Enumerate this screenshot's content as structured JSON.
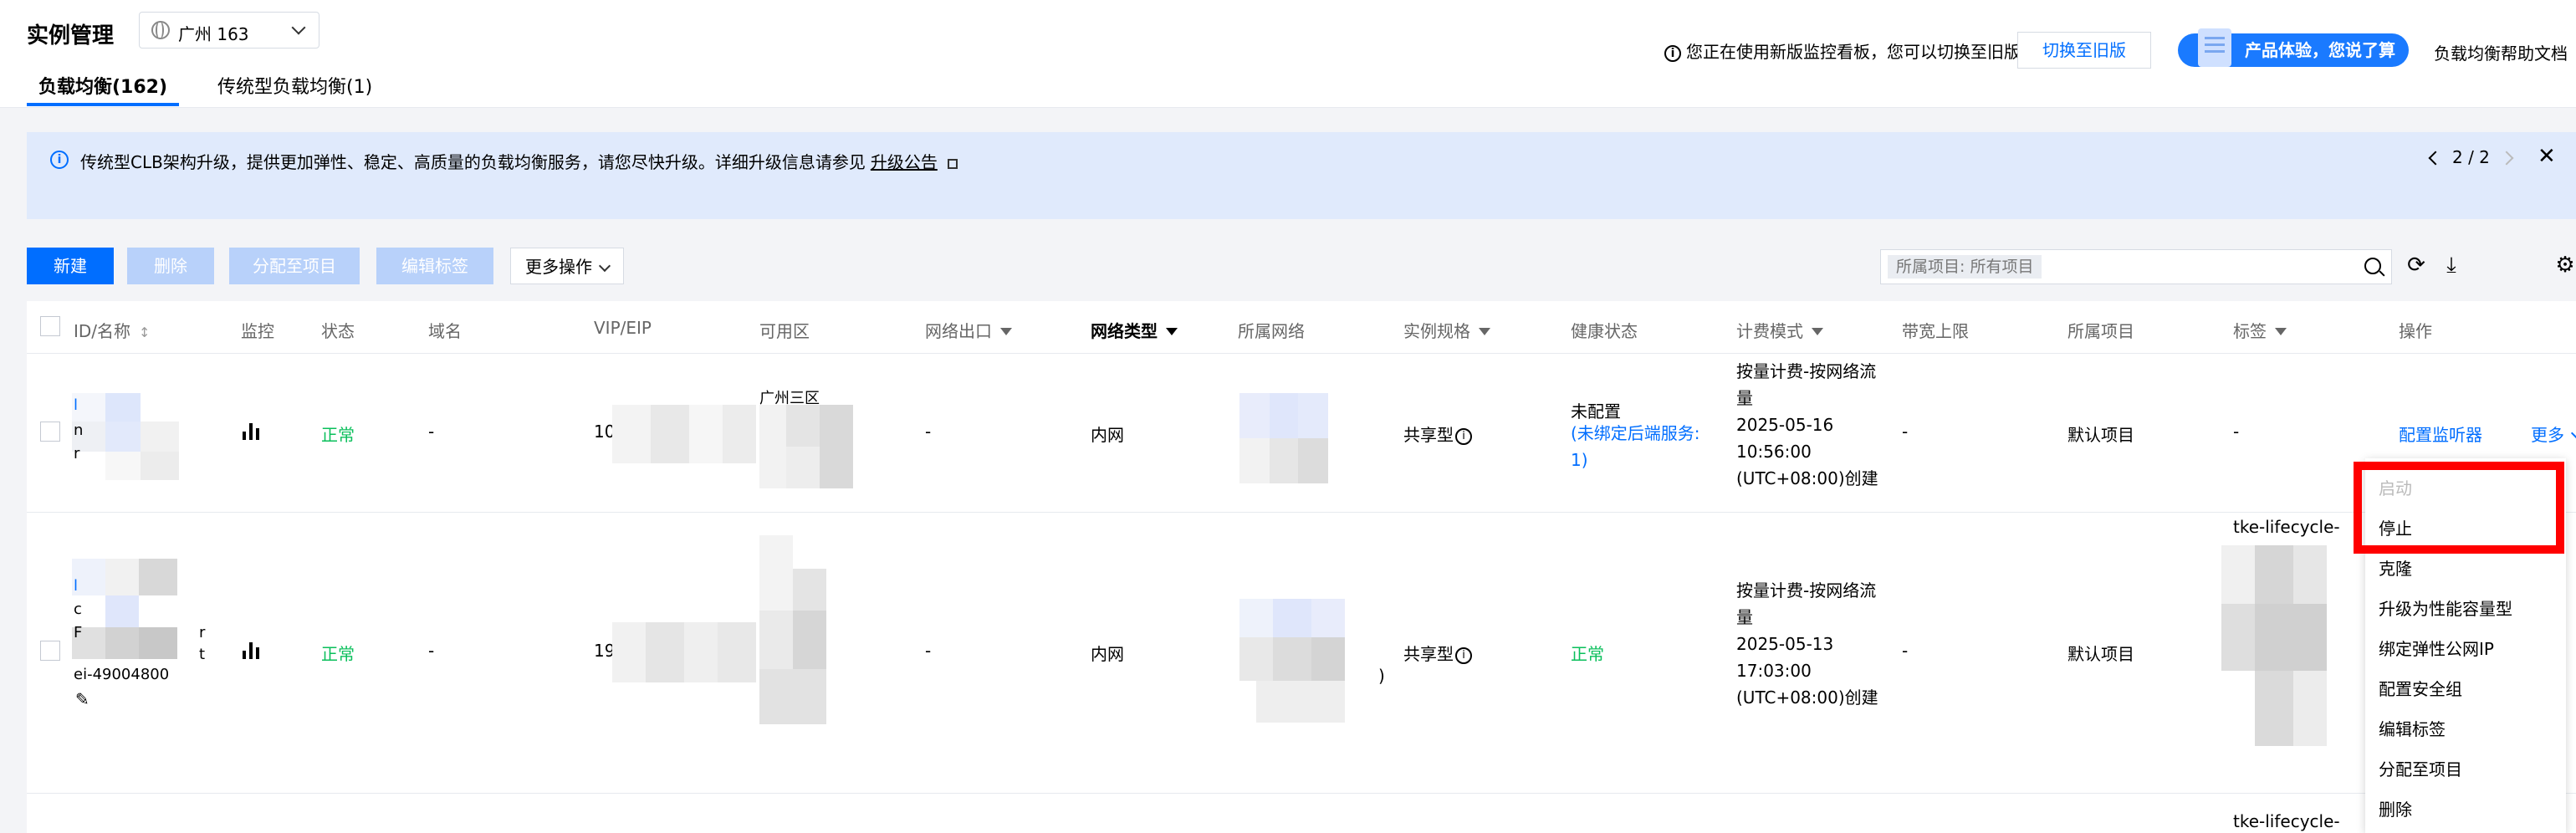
{
  "header": {
    "title": "实例管理",
    "region": "广州 163",
    "tabs": [
      {
        "label": "负载均衡(162)",
        "active": true
      },
      {
        "label": "传统型负载均衡(1)",
        "active": false
      }
    ],
    "monitor_notice": "您正在使用新版监控看板，您可以切换至旧版",
    "switch_button": "切换至旧版",
    "feedback_pill": "产品体验，您说了算",
    "help_doc": "负载均衡帮助文档"
  },
  "banner": {
    "text": "传统型CLB架构升级，提供更加弹性、稳定、高质量的负载均衡服务，请您尽快升级。详细升级信息请参见",
    "link": "升级公告",
    "page": "2 / 2"
  },
  "toolbar": {
    "new": "新建",
    "delete": "删除",
    "assign": "分配至项目",
    "edit_tags": "编辑标签",
    "more_ops": "更多操作",
    "search_chip": "所属项目: 所有项目"
  },
  "columns": {
    "id": "ID/名称",
    "monitor": "监控",
    "status": "状态",
    "domain": "域名",
    "vip": "VIP/EIP",
    "zone": "可用区",
    "egress": "网络出口",
    "net_type": "网络类型",
    "vpc": "所属网络",
    "spec": "实例规格",
    "health": "健康状态",
    "billing": "计费模式",
    "bandwidth": "带宽上限",
    "project": "所属项目",
    "tags": "标签",
    "actions": "操作"
  },
  "rows": [
    {
      "id_fragments": [
        "l",
        "n",
        "r"
      ],
      "status": "正常",
      "domain": "-",
      "vip_prefix": "10",
      "zone": "广州三区",
      "egress": "-",
      "net_type": "内网",
      "spec": "共享型",
      "health_title": "未配置",
      "health_link": "(未绑定后端服务: 1)",
      "billing": [
        "按量计费-按网络流",
        "量",
        "2025-05-16",
        "10:56:00",
        "(UTC+08:00)创建"
      ],
      "bandwidth": "-",
      "project": "默认项目",
      "tags": "-",
      "action_config": "配置监听器",
      "action_more": "更多"
    },
    {
      "id_fragments": [
        "l",
        "c",
        "F",
        "r",
        "t",
        "ei-49004800"
      ],
      "status": "正常",
      "domain": "-",
      "vip_prefix": "19",
      "egress": "-",
      "net_type": "内网",
      "vpc_suffix": ")",
      "spec": "共享型",
      "health": "正常",
      "billing": [
        "按量计费-按网络流",
        "量",
        "2025-05-13",
        "17:03:00",
        "(UTC+08:00)创建"
      ],
      "bandwidth": "-",
      "project": "默认项目",
      "tags": "tke-lifecycle-"
    },
    {
      "tags": "tke-lifecycle-"
    }
  ],
  "menu": {
    "items": [
      "启动",
      "停止",
      "克隆",
      "升级为性能容量型",
      "绑定弹性公网IP",
      "配置安全组",
      "编辑标签",
      "分配至项目",
      "删除"
    ],
    "disabled": [
      "启动"
    ]
  },
  "colors": {
    "accent": "#006eff",
    "success": "#0abf5b",
    "highlight": "#ff0000"
  }
}
